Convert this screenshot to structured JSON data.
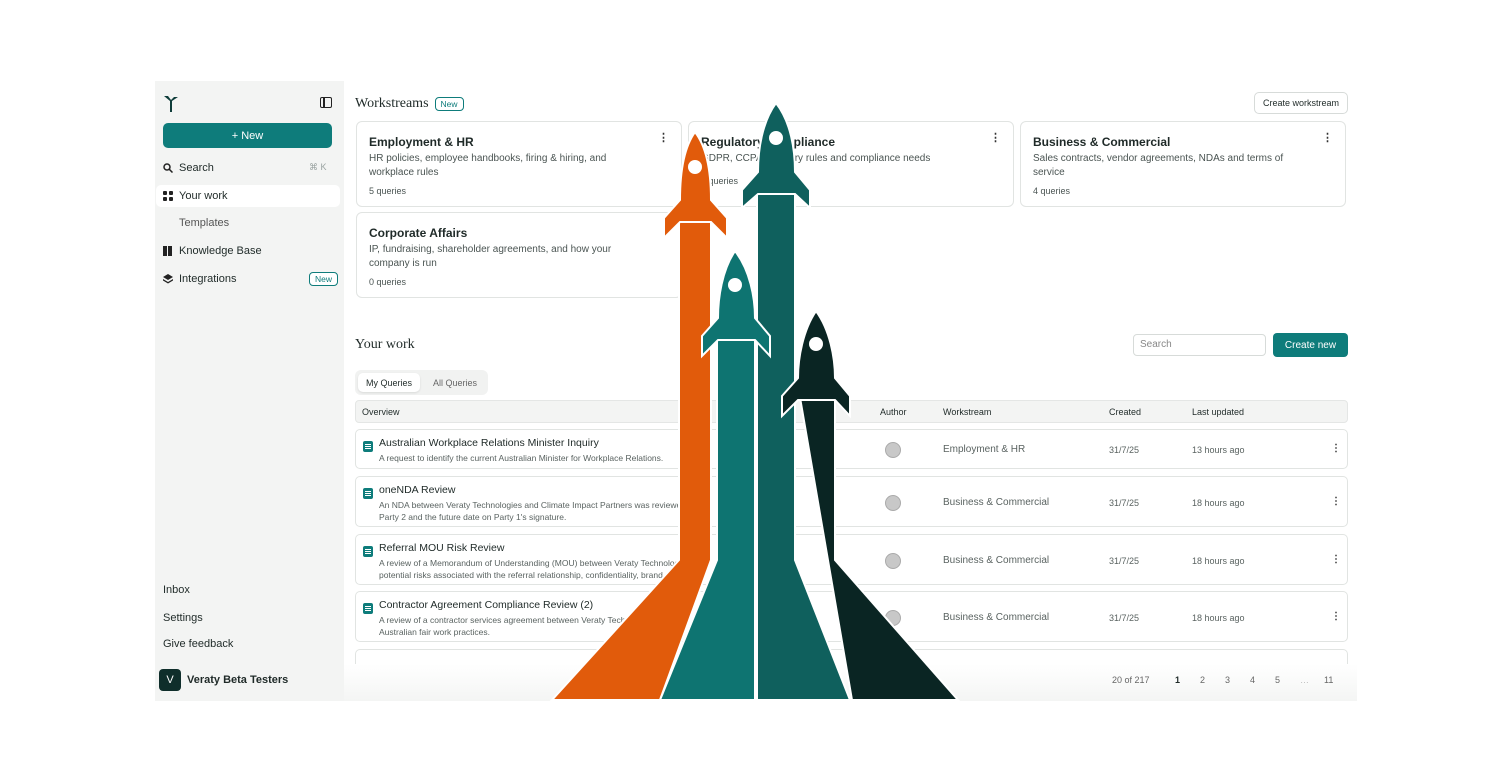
{
  "brand": {
    "accent": "#0e7c7b",
    "dark": "#0f2e2b"
  },
  "sidebar": {
    "new_label": "+ New",
    "search_label": "Search",
    "search_shortcut": "⌘ K",
    "items": [
      {
        "label": "Your work",
        "icon": "grid-icon"
      },
      {
        "label": "Templates"
      },
      {
        "label": "Knowledge Base",
        "icon": "book-icon"
      },
      {
        "label": "Integrations",
        "icon": "layers-icon",
        "badge": "New"
      }
    ],
    "bottom": [
      "Inbox",
      "Settings",
      "Give feedback"
    ],
    "org_initial": "V",
    "org_name": "Veraty Beta Testers"
  },
  "workstreams": {
    "title": "Workstreams",
    "badge": "New",
    "create_label": "Create workstream",
    "cards": [
      {
        "title": "Employment & HR",
        "desc": "HR policies, employee handbooks, firing & hiring, and workplace rules",
        "count": "5 queries"
      },
      {
        "title": "Regulatory Compliance",
        "desc": "GDPR, CCPA, industry rules and compliance needs",
        "count": "0 queries"
      },
      {
        "title": "Business & Commercial",
        "desc": "Sales contracts, vendor agreements, NDAs and terms of service",
        "count": "4 queries"
      },
      {
        "title": "Corporate Affairs",
        "desc": "IP, fundraising, shareholder agreements, and how your company is run",
        "count": "0 queries"
      }
    ]
  },
  "your_work": {
    "title": "Your work",
    "search_placeholder": "Search",
    "create_label": "Create new",
    "tabs": [
      "My Queries",
      "All Queries"
    ],
    "columns": [
      "Overview",
      "Author",
      "Workstream",
      "Created",
      "Last updated"
    ],
    "rows": [
      {
        "title": "Australian Workplace Relations Minister Inquiry",
        "desc": "A request to identify the current Australian Minister for Workplace Relations.",
        "workstream": "Employment & HR",
        "created": "31/7/25",
        "updated": "13 hours ago"
      },
      {
        "title": "oneNDA Review",
        "desc": "An NDA between Veraty Technologies and Climate Impact Partners was reviewed",
        "desc2": "Party 2 and the future date on Party 1's signature.",
        "workstream": "Business & Commercial",
        "created": "31/7/25",
        "updated": "18 hours ago"
      },
      {
        "title": "Referral MOU Risk Review",
        "desc": "A review of a Memorandum of Understanding (MOU) between Veraty Technologies",
        "desc2": "potential risks associated with the referral relationship, confidentiality, brand",
        "workstream": "Business & Commercial",
        "created": "31/7/25",
        "updated": "18 hours ago"
      },
      {
        "title": "Contractor Agreement Compliance Review (2)",
        "desc": "A review of a contractor services agreement between Veraty Technologies",
        "desc2": "Australian fair work practices.",
        "workstream": "Business & Commercial",
        "created": "31/7/25",
        "updated": "18 hours ago"
      }
    ],
    "pagination": {
      "summary": "20 of 217",
      "pages": [
        "1",
        "2",
        "3",
        "4",
        "5",
        "…",
        "11"
      ]
    }
  }
}
